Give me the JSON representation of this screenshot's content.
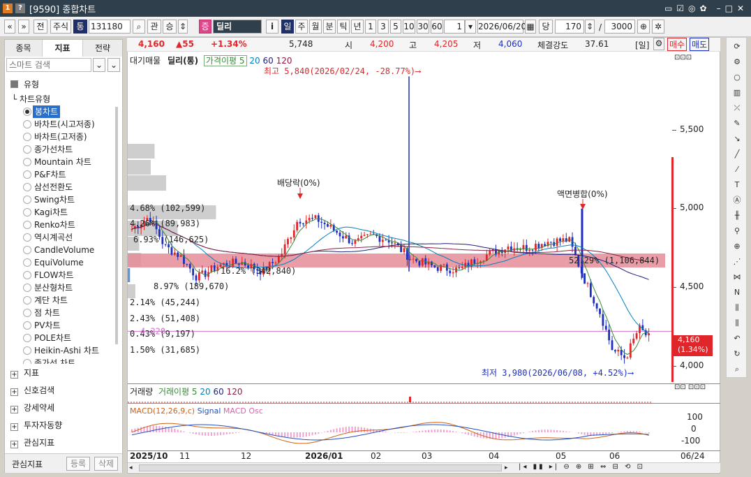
{
  "titlebar": {
    "code_label": "[9590] 종합차트",
    "icon1": "1",
    "icon2": "?"
  },
  "toolbar": {
    "nav_prev": "«",
    "nav_down": "»",
    "btn_jeon": "전",
    "btn_stock": "주식",
    "btn_tong": "통",
    "stock_code": "131180",
    "btn_gwan": "관",
    "btn_seung": "승",
    "btn_jeung": "증",
    "stock_name": "딜리",
    "btn_info": "i",
    "periods": [
      "일",
      "주",
      "월",
      "분",
      "틱",
      "년"
    ],
    "intervals": [
      "1",
      "3",
      "5",
      "10",
      "30",
      "60"
    ],
    "interval_input": "1",
    "date": "2026/06/20",
    "btn_dang": "당",
    "count": "170",
    "slash": "/",
    "total": "3000"
  },
  "left_panel": {
    "tabs": [
      "종목",
      "지표",
      "전략"
    ],
    "search_placeholder": "스마트 검색",
    "section_type": "유형",
    "subsection": "차트유형",
    "chart_types": [
      "봉차트",
      "바차트(시고저종)",
      "바차트(고저종)",
      "종가선차트",
      "Mountain 차트",
      "P&F차트",
      "삼선전환도",
      "Swing차트",
      "Kagi차트",
      "Renko차트",
      "역시계곡선",
      "CandleVolume",
      "EquiVolume",
      "FLOW차트",
      "분산형차트",
      "계단 차트",
      "점 차트",
      "PV차트",
      "POLE차트",
      "Heikin-Ashi 차트",
      "종가선 차트"
    ],
    "selected_index": 0,
    "sections": [
      "지표",
      "신호검색",
      "강세약세",
      "투자자동향",
      "관심지표"
    ],
    "bottom_label": "관심지표",
    "register": "등록",
    "delete": "삭제"
  },
  "info": {
    "price": "4,160",
    "change": "▲55",
    "rate": "+1.34%",
    "volume": "5,748",
    "open_label": "시",
    "open": "4,200",
    "high_label": "고",
    "high": "4,205",
    "low_label": "저",
    "low": "4,060",
    "strength_label": "체결강도",
    "strength": "37.61",
    "period_label": "[일]",
    "buy": "매수",
    "sell": "매도"
  },
  "chart": {
    "legend_main": [
      "대기매물",
      "딜리(통)",
      "가격이평 5",
      "20",
      "60",
      "120"
    ],
    "yaxis": [
      "5,500",
      "5,000",
      "4,500",
      "4,000"
    ],
    "annotations": {
      "high": "최고 5,840(2026/02/24, -28.77%)",
      "low": "최저 3,980(2026/06/08, +4.52%)",
      "dividend": "배당락(0%)",
      "split": "액면병합(0%)"
    },
    "price_tag": "4,160",
    "price_tag_rate": "(1.34%)",
    "supply_bands": [
      {
        "pct": "4.68%",
        "vol": "(102,599)",
        "w": 0.07
      },
      {
        "pct": "4.26%",
        "vol": "(89,983)",
        "w": 0.06
      },
      {
        "pct": "6.93%",
        "vol": "(146,625)",
        "w": 0.1
      },
      {
        "pct": "16.2%",
        "vol": "(342,840)",
        "w": 0.23
      },
      {
        "pct": "8.97%",
        "vol": "(189,670)",
        "w": 0.13
      },
      {
        "pct": "2.14%",
        "vol": "(45,244)",
        "w": 0.03
      },
      {
        "pct": "2.43%",
        "vol": "(51,408)",
        "w": 0.035
      },
      {
        "pct": "0.43%",
        "vol": "(9,197)",
        "w": 0.006
      },
      {
        "pct": "1.50%",
        "vol": "(31,685)",
        "w": 0.02
      }
    ],
    "band_highlight": "52.29% (1,106,844)",
    "hline_label": "4,220",
    "volume_legend": [
      "거래량",
      "거래이평 5",
      "20",
      "60",
      "120"
    ],
    "macd_legend": [
      "MACD(12,26,9,c)",
      "Signal",
      "MACD Osc"
    ],
    "macd_axis": [
      "100",
      "0",
      "-100"
    ],
    "xaxis": [
      "2025/10",
      "11",
      "12",
      "2026/01",
      "02",
      "03",
      "04",
      "05",
      "06"
    ],
    "x_end_label": "06/24"
  },
  "colors": {
    "up": "#e0262a",
    "down": "#1c2fbf",
    "band": "#e58c96",
    "supply": "#c9c9c9"
  }
}
